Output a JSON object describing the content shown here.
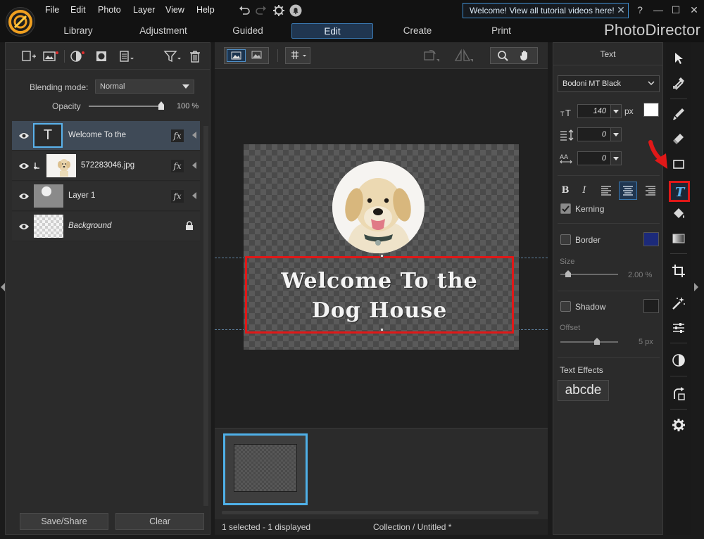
{
  "menu": {
    "items": [
      "File",
      "Edit",
      "Photo",
      "Layer",
      "View",
      "Help"
    ]
  },
  "notification": {
    "text": "Welcome! View all tutorial videos here!",
    "close": "✕"
  },
  "window_controls": {
    "help": "?",
    "minimize": "—",
    "maximize": "☐",
    "close": "✕"
  },
  "modes": {
    "tabs": [
      "Library",
      "Adjustment",
      "Guided",
      "Edit",
      "Create",
      "Print"
    ],
    "active": "Edit"
  },
  "app_name": "PhotoDirector",
  "layers_panel": {
    "blending_label": "Blending mode:",
    "blending_value": "Normal",
    "opacity_label": "Opacity",
    "opacity_value": "100 %",
    "opacity_level": 1.0,
    "layers": [
      {
        "name": "Welcome To the",
        "thumb": "T",
        "fx": "fx",
        "selected": true
      },
      {
        "name": "572283046.jpg",
        "fx": "fx"
      },
      {
        "name": "Layer 1",
        "fx": "fx"
      },
      {
        "name": "Background",
        "locked": true
      }
    ],
    "save_share": "Save/Share",
    "clear": "Clear"
  },
  "canvas": {
    "headline": "Welcome To the Dog House"
  },
  "status": {
    "selection": "1 selected - 1 displayed",
    "collection": "Collection / Untitled *"
  },
  "text_panel": {
    "title": "Text",
    "font": "Bodoni MT Black",
    "size_value": "140",
    "size_unit": "px",
    "line_spacing": "0",
    "char_spacing": "0",
    "format": {
      "bold": "B",
      "italic": "I"
    },
    "kerning_label": "Kerning",
    "kerning_checked": true,
    "text_color": "#ffffff",
    "border_label": "Border",
    "border_color": "#1c2a7a",
    "size_label": "Size",
    "size_pct": "2.00 %",
    "shadow_label": "Shadow",
    "shadow_color": "#1e1e1e",
    "offset_label": "Offset",
    "offset_value": "5 px",
    "effects_label": "Text Effects",
    "effects_sample": "abcde"
  },
  "colors": {
    "accent": "#3a78b0",
    "highlight_red": "#e01818",
    "selected_layer": "#3f4a57"
  }
}
